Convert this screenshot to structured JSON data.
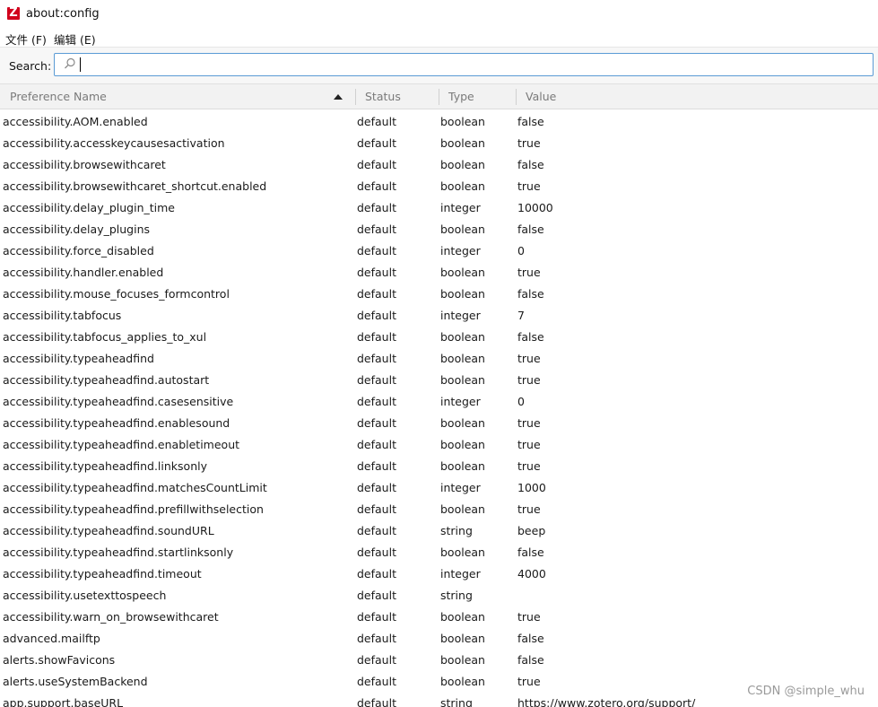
{
  "window": {
    "title": "about:config",
    "logo_letter": "Z",
    "logo_color": "#d1001c"
  },
  "menu": [
    {
      "label": "文件 (F)"
    },
    {
      "label": "编辑 (E)"
    }
  ],
  "search": {
    "label": "Search:",
    "value": "",
    "placeholder": "",
    "icon": "search-icon"
  },
  "table": {
    "columns": [
      "Preference Name",
      "Status",
      "Type",
      "Value"
    ],
    "sort": {
      "column": "Preference Name",
      "direction": "ascending"
    },
    "rows": [
      {
        "name": "accessibility.AOM.enabled",
        "status": "default",
        "type": "boolean",
        "value": "false"
      },
      {
        "name": "accessibility.accesskeycausesactivation",
        "status": "default",
        "type": "boolean",
        "value": "true"
      },
      {
        "name": "accessibility.browsewithcaret",
        "status": "default",
        "type": "boolean",
        "value": "false"
      },
      {
        "name": "accessibility.browsewithcaret_shortcut.enabled",
        "status": "default",
        "type": "boolean",
        "value": "true"
      },
      {
        "name": "accessibility.delay_plugin_time",
        "status": "default",
        "type": "integer",
        "value": "10000"
      },
      {
        "name": "accessibility.delay_plugins",
        "status": "default",
        "type": "boolean",
        "value": "false"
      },
      {
        "name": "accessibility.force_disabled",
        "status": "default",
        "type": "integer",
        "value": "0"
      },
      {
        "name": "accessibility.handler.enabled",
        "status": "default",
        "type": "boolean",
        "value": "true"
      },
      {
        "name": "accessibility.mouse_focuses_formcontrol",
        "status": "default",
        "type": "boolean",
        "value": "false"
      },
      {
        "name": "accessibility.tabfocus",
        "status": "default",
        "type": "integer",
        "value": "7"
      },
      {
        "name": "accessibility.tabfocus_applies_to_xul",
        "status": "default",
        "type": "boolean",
        "value": "false"
      },
      {
        "name": "accessibility.typeaheadfind",
        "status": "default",
        "type": "boolean",
        "value": "true"
      },
      {
        "name": "accessibility.typeaheadfind.autostart",
        "status": "default",
        "type": "boolean",
        "value": "true"
      },
      {
        "name": "accessibility.typeaheadfind.casesensitive",
        "status": "default",
        "type": "integer",
        "value": "0"
      },
      {
        "name": "accessibility.typeaheadfind.enablesound",
        "status": "default",
        "type": "boolean",
        "value": "true"
      },
      {
        "name": "accessibility.typeaheadfind.enabletimeout",
        "status": "default",
        "type": "boolean",
        "value": "true"
      },
      {
        "name": "accessibility.typeaheadfind.linksonly",
        "status": "default",
        "type": "boolean",
        "value": "true"
      },
      {
        "name": "accessibility.typeaheadfind.matchesCountLimit",
        "status": "default",
        "type": "integer",
        "value": "1000"
      },
      {
        "name": "accessibility.typeaheadfind.prefillwithselection",
        "status": "default",
        "type": "boolean",
        "value": "true"
      },
      {
        "name": "accessibility.typeaheadfind.soundURL",
        "status": "default",
        "type": "string",
        "value": "beep"
      },
      {
        "name": "accessibility.typeaheadfind.startlinksonly",
        "status": "default",
        "type": "boolean",
        "value": "false"
      },
      {
        "name": "accessibility.typeaheadfind.timeout",
        "status": "default",
        "type": "integer",
        "value": "4000"
      },
      {
        "name": "accessibility.usetexttospeech",
        "status": "default",
        "type": "string",
        "value": ""
      },
      {
        "name": "accessibility.warn_on_browsewithcaret",
        "status": "default",
        "type": "boolean",
        "value": "true"
      },
      {
        "name": "advanced.mailftp",
        "status": "default",
        "type": "boolean",
        "value": "false"
      },
      {
        "name": "alerts.showFavicons",
        "status": "default",
        "type": "boolean",
        "value": "false"
      },
      {
        "name": "alerts.useSystemBackend",
        "status": "default",
        "type": "boolean",
        "value": "true"
      },
      {
        "name": "app.support.baseURL",
        "status": "default",
        "type": "string",
        "value": "https://www.zotero.org/support/"
      }
    ]
  },
  "watermark": "CSDN @simple_whu"
}
